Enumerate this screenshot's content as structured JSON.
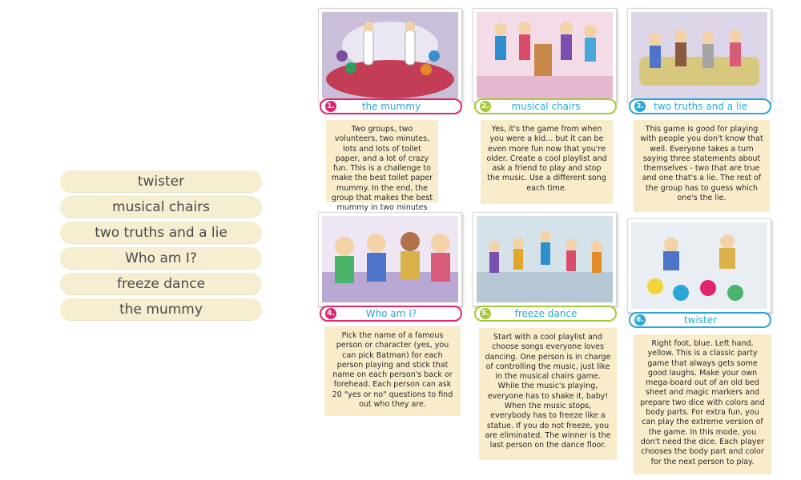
{
  "word_list": [
    "twister",
    "musical chairs",
    "two truths and a lie",
    "Who am I?",
    "freeze dance",
    "the mummy"
  ],
  "cards": [
    {
      "num": "1.",
      "title": "the mummy",
      "color": "#e0266e",
      "title_color": "#2aa7d8",
      "text": "Two groups, two volunteers, two minutes, lots and lots of toilet paper, and a lot of crazy fun. This is a challenge to make the best toilet paper mummy. In the end, the group that makes the best mummy in two minutes wins."
    },
    {
      "num": "2.",
      "title": "musical chairs",
      "color": "#a6c93a",
      "title_color": "#2aa7d8",
      "text": "Yes, it's the game from when you were a kid... but it can be even more fun now that you're older. Create a cool playlist and ask a friend to play and stop the music. Use a different song each time."
    },
    {
      "num": "3.",
      "title": "two truths and a lie",
      "color": "#2aa7d8",
      "title_color": "#2aa7d8",
      "text": "This game is good for playing with people you don't know that well. Everyone takes a turn saying three statements about themselves - two that are true and one that's a lie. The rest of the group has to guess which one's the lie."
    },
    {
      "num": "4.",
      "title": "Who am I?",
      "color": "#e0266e",
      "title_color": "#2aa7d8",
      "text": "Pick the name of a famous person or character (yes, you can pick Batman) for each person playing and stick that name on each person's back or forehead. Each person can ask 20 \"yes or no\" questions to find out who they are."
    },
    {
      "num": "5.",
      "title": "freeze dance",
      "color": "#a6c93a",
      "title_color": "#2aa7d8",
      "text": "Start with a cool playlist and choose songs everyone loves dancing. One person is in charge of controlling the music, just like in the musical chairs game. While the music's playing, everyone has to shake it, baby! When the music stops, everybody has to freeze like a statue. If you do not freeze, you are eliminated. The winner is the last person on the dance floor."
    },
    {
      "num": "6.",
      "title": "twister",
      "color": "#2aa7d8",
      "title_color": "#2aa7d8",
      "text": "Right foot, blue. Left hand, yellow. This is a classic party game that always gets some good laughs. Make your own mega-board out of an old bed sheet and magic markers and prepare two dice with colors and body parts. For extra fun, you can play the extreme version of the game. In this mode, you don't need the dice. Each player chooses the body part and color for the next person to play."
    }
  ]
}
